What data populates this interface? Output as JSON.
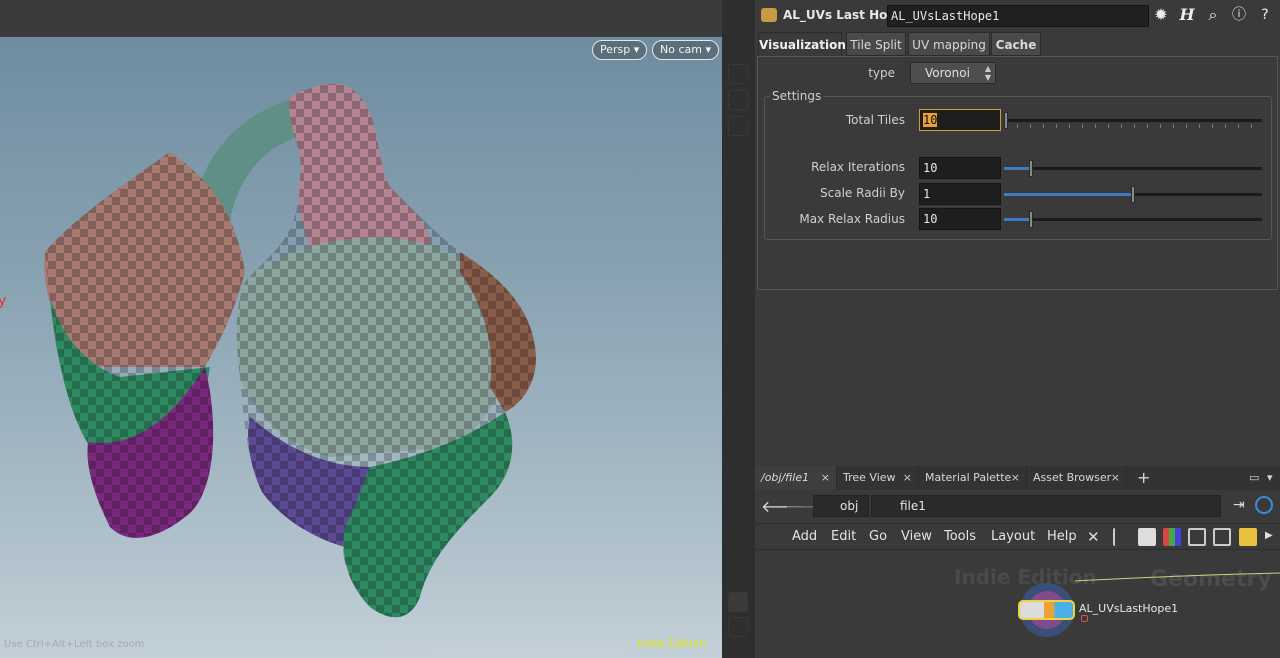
{
  "viewport": {
    "persp_label": "Persp",
    "cam_label": "No cam",
    "watermark": "Indie Edition",
    "hint": "Use Ctrl+Alt+Left box zoom",
    "edge_mark": "y"
  },
  "param_pane": {
    "node_type": "AL_UVs Last Hope",
    "node_name": "AL_UVsLastHope1",
    "tabs": [
      "Visualization",
      "Tile Split",
      "UV mapping",
      "Cache"
    ],
    "active_tab": "Visualization",
    "type_label": "type",
    "type_value": "Voronoi",
    "settings_legend": "Settings",
    "params": [
      {
        "label": "Total Tiles",
        "value": "10",
        "slider_fraction": 0.0
      },
      {
        "label": "Relax Iterations",
        "value": "10",
        "slider_fraction": 0.1
      },
      {
        "label": "Scale Radii By",
        "value": "1",
        "slider_fraction": 0.5
      },
      {
        "label": "Max Relax Radius",
        "value": "10",
        "slider_fraction": 0.1
      }
    ]
  },
  "network": {
    "tabs": [
      "/obj/file1",
      "Tree View",
      "Material Palette",
      "Asset Browser"
    ],
    "path": [
      "obj",
      "file1"
    ],
    "menu": [
      "Add",
      "Edit",
      "Go",
      "View",
      "Tools",
      "Layout",
      "Help"
    ],
    "watermark_left": "Indie Edition",
    "watermark_right": "Geometry",
    "node_label": "AL_UVsLastHope1"
  },
  "colors": {
    "accent_orange": "#e9a13a",
    "slider_blue": "#3c7cc2",
    "watermark_yellow": "#e8e800"
  }
}
